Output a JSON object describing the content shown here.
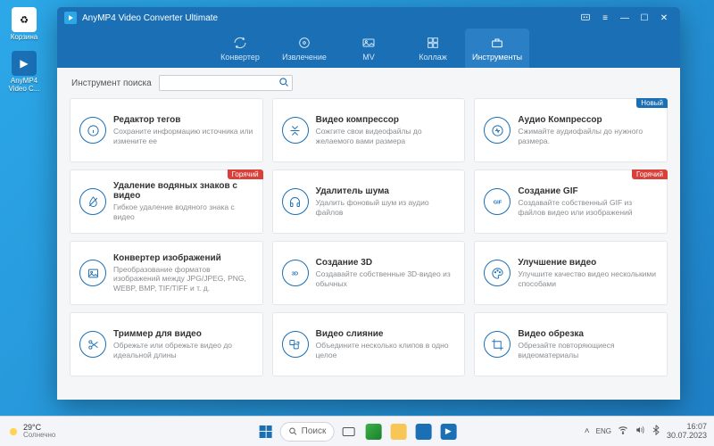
{
  "desktop": {
    "icons": [
      {
        "label": "Корзина"
      },
      {
        "label": "AnyMP4 Video C..."
      }
    ]
  },
  "window": {
    "title": "AnyMP4 Video Converter Ultimate"
  },
  "tabs": [
    {
      "label": "Конвертер"
    },
    {
      "label": "Извлечение"
    },
    {
      "label": "MV"
    },
    {
      "label": "Коллаж"
    },
    {
      "label": "Инструменты"
    }
  ],
  "active_tab_index": 4,
  "search": {
    "label": "Инструмент поиска",
    "value": ""
  },
  "badges": {
    "new": "Новый",
    "hot": "Горячий"
  },
  "tools": [
    {
      "title": "Редактор тегов",
      "desc": "Сохраните информацию источника или измените ее",
      "icon": "info",
      "badge": null
    },
    {
      "title": "Видео компрессор",
      "desc": "Сожгите свои видеофайлы до желаемого вами размера",
      "icon": "compress",
      "badge": null
    },
    {
      "title": "Аудио Компрессор",
      "desc": "Сжимайте аудиофайлы до нужного размера.",
      "icon": "audio-compress",
      "badge": "new"
    },
    {
      "title": "Удаление водяных знаков с видео",
      "desc": "Гибкое удаление водяного знака с видео",
      "icon": "drop",
      "badge": "hot"
    },
    {
      "title": "Удалитель шума",
      "desc": "Удалить фоновый шум из аудио файлов",
      "icon": "headphones",
      "badge": null
    },
    {
      "title": "Создание GIF",
      "desc": "Создавайте собственный GIF из файлов видео или изображений",
      "icon": "gif",
      "badge": "hot"
    },
    {
      "title": "Конвертер изображений",
      "desc": "Преобразование форматов изображений между JPG/JPEG, PNG, WEBP, BMP, TIF/TIFF и т. д.",
      "icon": "image",
      "badge": null
    },
    {
      "title": "Создание 3D",
      "desc": "Создавайте собственные 3D-видео из обычных",
      "icon": "3d",
      "badge": null
    },
    {
      "title": "Улучшение видео",
      "desc": "Улучшите качество видео несколькими способами",
      "icon": "palette",
      "badge": null
    },
    {
      "title": "Триммер для видео",
      "desc": "Обрежьте или обрежьте видео до идеальной длины",
      "icon": "scissors",
      "badge": null
    },
    {
      "title": "Видео слияние",
      "desc": "Объедините несколько клипов в одно целое",
      "icon": "merge",
      "badge": null
    },
    {
      "title": "Видео обрезка",
      "desc": "Обрезайте повторяющиеся видеоматериалы",
      "icon": "crop",
      "badge": null
    }
  ],
  "taskbar": {
    "weather_temp": "29°C",
    "weather_cond": "Солнечно",
    "search_placeholder": "Поиск",
    "lang": "ENG",
    "time": "16:07",
    "date": "30.07.2023"
  }
}
